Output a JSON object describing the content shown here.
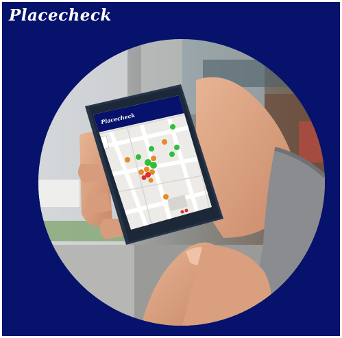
{
  "brand": {
    "logo_text": "Placecheck",
    "background_color": "#06126b",
    "logo_color": "#ffffff"
  },
  "photo": {
    "phone_app_title": "Placecheck",
    "map_marker_colors": [
      "#2fbf3a",
      "#e8892a",
      "#d9322e"
    ]
  }
}
